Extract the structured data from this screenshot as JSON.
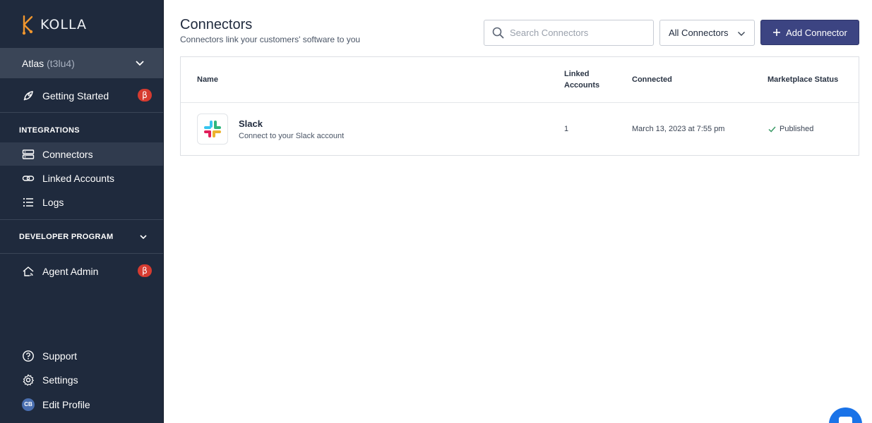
{
  "brand": {
    "name": "KOLLA"
  },
  "workspace": {
    "name": "Atlas",
    "code": "(t3lu4)"
  },
  "sidebar": {
    "getting_started": {
      "label": "Getting Started",
      "badge": "β"
    },
    "integrations_heading": "INTEGRATIONS",
    "integrations": [
      {
        "label": "Connectors",
        "icon": "server-icon",
        "active": true
      },
      {
        "label": "Linked Accounts",
        "icon": "link-icon",
        "active": false
      },
      {
        "label": "Logs",
        "icon": "list-icon",
        "active": false
      }
    ],
    "developer_heading": "DEVELOPER PROGRAM",
    "agent_admin": {
      "label": "Agent Admin",
      "badge": "β"
    },
    "footer": [
      {
        "label": "Support",
        "icon": "help-icon"
      },
      {
        "label": "Settings",
        "icon": "gear-icon"
      },
      {
        "label": "Edit Profile",
        "icon": "avatar",
        "initials": "CB"
      }
    ]
  },
  "header": {
    "title": "Connectors",
    "subtitle": "Connectors link your customers' software to you"
  },
  "toolbar": {
    "search_placeholder": "Search Connectors",
    "filter_value": "All Connectors",
    "add_label": "Add Connector"
  },
  "table": {
    "columns": {
      "name": "Name",
      "linked_line1": "Linked",
      "linked_line2": "Accounts",
      "connected": "Connected",
      "status": "Marketplace Status"
    },
    "rows": [
      {
        "name": "Slack",
        "description": "Connect to your Slack account",
        "linked_accounts": "1",
        "connected": "March 13, 2023 at 7:55 pm",
        "status": "Published"
      }
    ]
  },
  "colors": {
    "sidebar_bg": "#1f2a3d",
    "accent": "#3c4482",
    "logo_orange": "#f0962e",
    "beta_red": "#d63b30",
    "success_green": "#3a9a66",
    "chat_blue": "#1a73e8"
  }
}
